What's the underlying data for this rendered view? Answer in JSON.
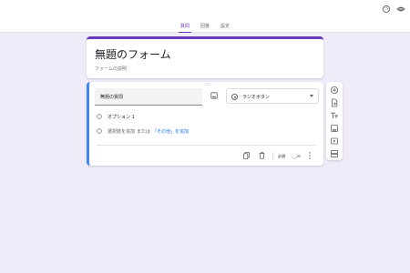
{
  "tabs": [
    {
      "label": "質問",
      "active": true
    },
    {
      "label": "回答",
      "active": false
    },
    {
      "label": "設定",
      "active": false
    }
  ],
  "header_icons": [
    "palette-icon",
    "eye-icon"
  ],
  "form": {
    "title": "無題のフォーム",
    "description": "フォームの説明"
  },
  "question": {
    "title": "無題の質問",
    "type": "ラジオボタン",
    "options": [
      {
        "label": "オプション 1"
      }
    ],
    "add_option": "選択肢を追加",
    "or": "または",
    "add_other": "「その他」を追加",
    "required_label": "必須",
    "required": false
  },
  "colors": {
    "accent": "#673ab7",
    "background": "#f0ebf8",
    "focus": "#4285f4",
    "link": "#1a73e8"
  },
  "side_icons": [
    "add-question-icon",
    "import-questions-icon",
    "add-title-icon",
    "add-image-icon",
    "add-video-icon",
    "add-section-icon"
  ]
}
